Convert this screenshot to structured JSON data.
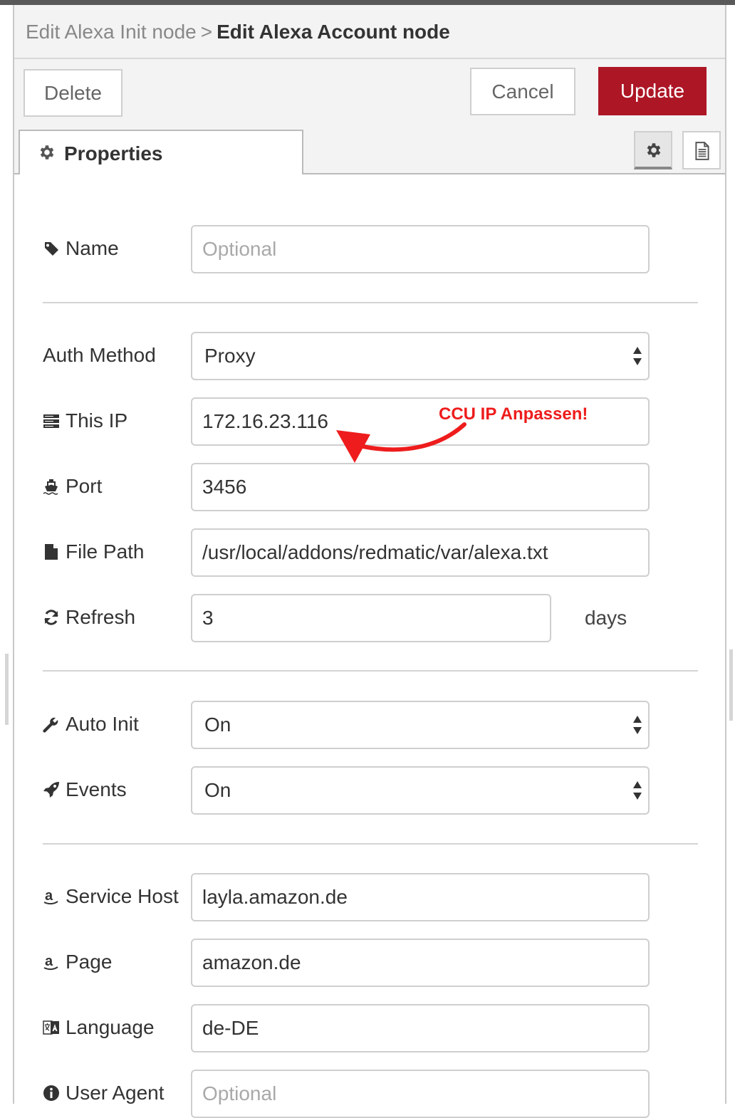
{
  "breadcrumb": {
    "parent": "Edit Alexa Init node",
    "separator": ">",
    "current": "Edit Alexa Account node"
  },
  "toolbar": {
    "delete_label": "Delete",
    "cancel_label": "Cancel",
    "update_label": "Update"
  },
  "tabs": {
    "properties_label": "Properties"
  },
  "colors": {
    "accent": "#ad1625",
    "annotation": "#ee1c1c"
  },
  "icons": {
    "tab": "gear-icon",
    "info": "file-text-icon"
  },
  "form": {
    "name": {
      "label": "Name",
      "placeholder": "Optional",
      "icon": "tag-icon"
    },
    "auth_method": {
      "label": "Auth Method",
      "value": "Proxy"
    },
    "this_ip": {
      "label": "This IP",
      "value": "172.16.23.116",
      "icon": "server-icon"
    },
    "port": {
      "label": "Port",
      "value": "3456",
      "icon": "ship-icon"
    },
    "file_path": {
      "label": "File Path",
      "value": "/usr/local/addons/redmatic/var/alexa.txt",
      "icon": "file-icon"
    },
    "refresh": {
      "label": "Refresh",
      "value": "3",
      "unit": "days",
      "icon": "refresh-icon"
    },
    "auto_init": {
      "label": "Auto Init",
      "value": "On",
      "icon": "wrench-icon"
    },
    "events": {
      "label": "Events",
      "value": "On",
      "icon": "rocket-icon"
    },
    "service_host": {
      "label": "Service Host",
      "value": "layla.amazon.de",
      "icon": "amazon-icon"
    },
    "page": {
      "label": "Page",
      "value": "amazon.de",
      "icon": "amazon-icon"
    },
    "language": {
      "label": "Language",
      "value": "de-DE",
      "icon": "language-icon"
    },
    "user_agent": {
      "label": "User Agent",
      "placeholder": "Optional",
      "icon": "info-circle-icon"
    }
  },
  "annotation": {
    "text": "CCU IP Anpassen!"
  }
}
